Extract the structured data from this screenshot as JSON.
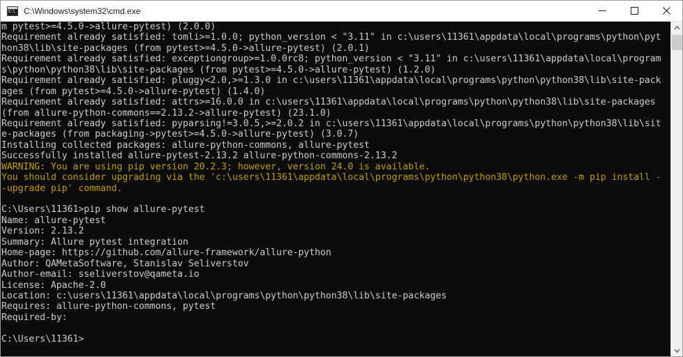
{
  "window": {
    "title": "C:\\Windows\\system32\\cmd.exe",
    "icon": "console-icon",
    "icon_glyph": "C:\\",
    "controls": {
      "minimize_label": "Minimize",
      "maximize_label": "Maximize",
      "close_label": "Close"
    }
  },
  "colors": {
    "console_background": "#0c0c0c",
    "console_foreground": "#cccccc",
    "warning_foreground": "#c19c00",
    "titlebar_background": "#ffffff",
    "titlebar_foreground": "#1a1a1a",
    "scrollbar_track": "#f0f0f0",
    "scrollbar_thumb": "#cdcdcd"
  },
  "scrollbar": {
    "up_arrow": "chevron-up-icon",
    "down_arrow": "chevron-down-icon",
    "thumb_position_percent": 2
  },
  "console": {
    "prompt": "C:\\Users\\11361>",
    "lines": [
      {
        "text": "m pytest>=4.5.0->allure-pytest) (2.0.0)",
        "style": "normal"
      },
      {
        "text": "Requirement already satisfied: tomli>=1.0.0; python_version < \"3.11\" in c:\\users\\11361\\appdata\\local\\programs\\python\\pyt",
        "style": "normal"
      },
      {
        "text": "hon38\\lib\\site-packages (from pytest>=4.5.0->allure-pytest) (2.0.1)",
        "style": "normal"
      },
      {
        "text": "Requirement already satisfied: exceptiongroup>=1.0.0rc8; python_version < \"3.11\" in c:\\users\\11361\\appdata\\local\\program",
        "style": "normal"
      },
      {
        "text": "s\\python\\python38\\lib\\site-packages (from pytest>=4.5.0->allure-pytest) (1.2.0)",
        "style": "normal"
      },
      {
        "text": "Requirement already satisfied: pluggy<2.0,>=1.3.0 in c:\\users\\11361\\appdata\\local\\programs\\python\\python38\\lib\\site-pack",
        "style": "normal"
      },
      {
        "text": "ages (from pytest>=4.5.0->allure-pytest) (1.4.0)",
        "style": "normal"
      },
      {
        "text": "Requirement already satisfied: attrs>=16.0.0 in c:\\users\\11361\\appdata\\local\\programs\\python\\python38\\lib\\site-packages",
        "style": "normal"
      },
      {
        "text": "(from allure-python-commons==2.13.2->allure-pytest) (23.1.0)",
        "style": "normal"
      },
      {
        "text": "Requirement already satisfied: pyparsing!=3.0.5,>=2.0.2 in c:\\users\\11361\\appdata\\local\\programs\\python\\python38\\lib\\sit",
        "style": "normal"
      },
      {
        "text": "e-packages (from packaging->pytest>=4.5.0->allure-pytest) (3.0.7)",
        "style": "normal"
      },
      {
        "text": "Installing collected packages: allure-python-commons, allure-pytest",
        "style": "normal"
      },
      {
        "text": "Successfully installed allure-pytest-2.13.2 allure-python-commons-2.13.2",
        "style": "normal"
      },
      {
        "text": "WARNING: You are using pip version 20.2.3; however, version 24.0 is available.",
        "style": "warn"
      },
      {
        "text": "You should consider upgrading via the 'c:\\users\\11361\\appdata\\local\\programs\\python\\python38\\python.exe -m pip install -",
        "style": "warn"
      },
      {
        "text": "-upgrade pip' command.",
        "style": "warn"
      },
      {
        "text": "",
        "style": "normal"
      },
      {
        "text": "C:\\Users\\11361>pip show allure-pytest",
        "style": "normal"
      },
      {
        "text": "Name: allure-pytest",
        "style": "normal"
      },
      {
        "text": "Version: 2.13.2",
        "style": "normal"
      },
      {
        "text": "Summary: Allure pytest integration",
        "style": "normal"
      },
      {
        "text": "Home-page: https://github.com/allure-framework/allure-python",
        "style": "normal"
      },
      {
        "text": "Author: QAMetaSoftware, Stanislav Seliverstov",
        "style": "normal"
      },
      {
        "text": "Author-email: sseliverstov@qameta.io",
        "style": "normal"
      },
      {
        "text": "License: Apache-2.0",
        "style": "normal"
      },
      {
        "text": "Location: c:\\users\\11361\\appdata\\local\\programs\\python\\python38\\lib\\site-packages",
        "style": "normal"
      },
      {
        "text": "Requires: allure-python-commons, pytest",
        "style": "normal"
      },
      {
        "text": "Required-by:",
        "style": "normal"
      },
      {
        "text": "",
        "style": "normal"
      },
      {
        "text": "C:\\Users\\11361>",
        "style": "normal"
      }
    ]
  }
}
